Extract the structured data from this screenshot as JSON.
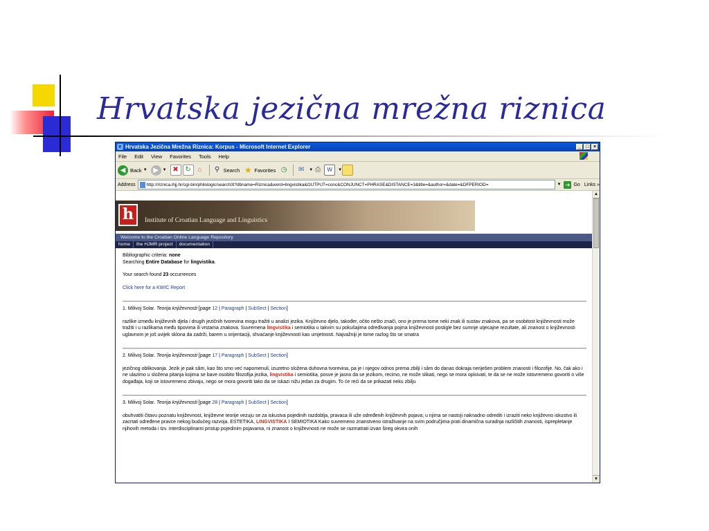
{
  "slide": {
    "title": "Hrvatska jezična mrežna riznica"
  },
  "window": {
    "title": "Hrvatska Jezična Mrežna Riznica: Korpus - Microsoft Internet Explorer",
    "minimize": "_",
    "maximize": "□",
    "close": "×"
  },
  "menu": [
    "File",
    "Edit",
    "View",
    "Favorites",
    "Tools",
    "Help"
  ],
  "toolbar": {
    "back": "Back",
    "search": "Search",
    "favorites": "Favorites"
  },
  "address": {
    "label": "Address",
    "url": "http://riznica.ihjj.hr/cgi-bin/philologic/search3t?dbname=Riznica&word=lingvistika&OUTPUT=conc&CONJUNCT=PHRASE&DISTANCE=3&title=&author=&date=&DFPERIOD=",
    "go": "Go",
    "links": "Links"
  },
  "site": {
    "institute": "Institute of Croatian Language and Linguistics",
    "welcome": "Welcome to the Croatian Online Language Repository",
    "nav": [
      "home",
      "the HJMR project",
      "documentation"
    ]
  },
  "results": {
    "criteria_label": "Bibliographic criteria:",
    "criteria_value": "none",
    "searching_prefix": "Searching",
    "searching_db": "Entire Database",
    "searching_for": "for",
    "searching_word": "lingvistika",
    "found_prefix": "Your search found",
    "found_count": "23",
    "found_suffix": "occurrences",
    "kwic_link": "Click here for a KWIC Report",
    "entries": [
      {
        "head": "1. Milivoj Solar.",
        "title": "Teorija književnosti",
        "page_label": "[page",
        "page": "12",
        "paragraph": "Paragraph",
        "subsect": "SubSect",
        "section": "Section",
        "pre": "razlike između književnih djela i drugih jezičnih tvorevina mogu tražiti u analizi jezika. Književno djelo, također, očito nešto znači, ono je prema tome neki znak ili sustav znakova, pa se osobitost književnosti može tražiti i u razlikama među tipovima ili vrstama znakova. Suvremena",
        "kw": "lingvistika",
        "post": "i semiotika u takvim su pokušajima određivanja pojma književnosti postigle bez sumnje utjecajne rezultate, ali znanost o književnosti uglavnom je još uvijek sklona da zadrži, barem u orijentaciji, shvaćanje književnosti kao umjetnosti. Najvažniji je tome razlog što se smatra"
      },
      {
        "head": "2. Milivoj Solar.",
        "title": "Teorija književnosti",
        "page_label": "[page",
        "page": "17",
        "paragraph": "Paragraph",
        "subsect": "SubSect",
        "section": "Section",
        "pre": "jezičnog oblikovanja. Jezik je pak sâm, kao što smo već napomenuli, izuzetno složena duhovna tvorevina, pa je i njegov odnos prema zbilji i sâm do danas dokraja neriješen problem znanosti i filozofije. No, čak ako i ne ulazimo u složena pitanja kojima se bave osobito filozofija jezika,",
        "kw": "lingvistika",
        "post": "i semiotika, posve je jasno da se jezikom, recimo, ne može slikati, nego se mora opisivati, te da se ne može istovremeno govoriti o više događaja, koji se istovremeno zbivaju, nego se mora govoriti tako da se iskazi nižu jedan za drugim. To će reći da se prikazati neku zbilju"
      },
      {
        "head": "3. Milivoj Solar.",
        "title": "Teorija književnosti",
        "page_label": "[page",
        "page": "28",
        "paragraph": "Paragraph",
        "subsect": "SubSect",
        "section": "Section",
        "pre": "obuhvatiti čitavu poznatu književnost, književne teorije vezuju se za iskustva pojedinih razdoblja, pravaca ili uže određenih književnih pojava; u njima se nastoji naknadno odrediti i izraziti neko književno iskustvo ili zacrtati određene pravce nekog budućeg razvoja. ESTETIKA,",
        "kw": "LINGVISTIKA",
        "post": "I SEMIOTIKA Kako suvremeno znanstveno istraživanje na svim područjima prati dinamična suradnja različitih znanosti, isprepletanje njihovih metoda i tzv. interdisciplinarni pristup pojedinim pojavama, ni znanost o književnosti ne može se razmatrati izvan šireg okvira onih"
      }
    ]
  },
  "colors": {
    "title": "#2a2a9a",
    "highlight": "#cc2a1a",
    "link": "#1a3aa8",
    "nav_bg": "#1c2448"
  }
}
